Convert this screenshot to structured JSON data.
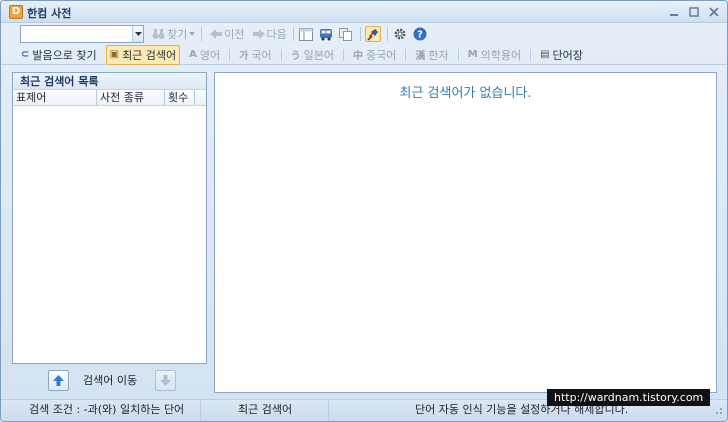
{
  "window": {
    "title": "한컴 사전",
    "logo_letter": "D"
  },
  "toolbar1": {
    "search_value": "",
    "find_label": "찾기",
    "prev_label": "이전",
    "next_label": "다음"
  },
  "toolbar2": {
    "items": [
      {
        "label": "발음으로 찾기",
        "glyph": "⊂",
        "state": "normal"
      },
      {
        "label": "최근 검색어",
        "glyph": "▣",
        "state": "selected"
      },
      {
        "label": "영어",
        "glyph": "A",
        "state": "disabled"
      },
      {
        "label": "국어",
        "glyph": "가",
        "state": "disabled"
      },
      {
        "label": "일본어",
        "glyph": "う",
        "state": "disabled"
      },
      {
        "label": "중국어",
        "glyph": "中",
        "state": "disabled"
      },
      {
        "label": "한자",
        "glyph": "漢",
        "state": "disabled"
      },
      {
        "label": "의학용어",
        "glyph": "M",
        "state": "disabled"
      },
      {
        "label": "단어장",
        "glyph": "▤",
        "state": "normal"
      }
    ]
  },
  "left_panel": {
    "title": "최근 검색어 목록",
    "columns": [
      "표제어",
      "사전 종류",
      "횟수",
      ""
    ],
    "move_label": "검색어 이동"
  },
  "right_panel": {
    "empty_message": "최근 검색어가 없습니다."
  },
  "statusbar": {
    "search_condition": "검색 조건 : -과(와) 일치하는 단어",
    "mode": "최근 검색어",
    "hint": "단어 자동 인식 기능을 설정하거나 해제합니다."
  },
  "watermark": "http://wardnam.tistory.com",
  "colors": {
    "accent": "#2f7fb6",
    "selected_bg": "#fde9b5",
    "frame": "#8aa6c8"
  }
}
